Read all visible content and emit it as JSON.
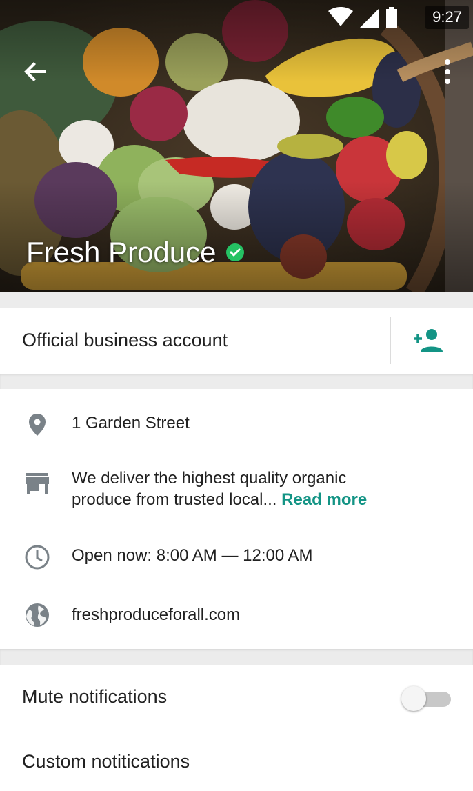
{
  "status_bar": {
    "time": "9:27"
  },
  "header": {
    "title": "Fresh Produce",
    "verified": true,
    "back_icon": "arrow-back-icon",
    "menu_icon": "more-vert-icon"
  },
  "business": {
    "label": "Official business account",
    "add_contact_icon": "person-add-icon"
  },
  "info": {
    "address": "1 Garden Street",
    "description": "We deliver the highest quality organic produce from trusted local...",
    "description_line1": "We deliver the highest quality organic",
    "description_line2": "produce from trusted local...",
    "read_more": "Read more",
    "hours": "Open now: 8:00 AM — 12:00 AM",
    "website": "freshproduceforall.com"
  },
  "settings": {
    "mute_label": "Mute notifications",
    "mute_enabled": false,
    "custom_label": "Custom notitications"
  },
  "colors": {
    "accent": "#139485",
    "verified_badge": "#25c264",
    "icon_gray": "#7a8288",
    "divider": "#ececec"
  }
}
